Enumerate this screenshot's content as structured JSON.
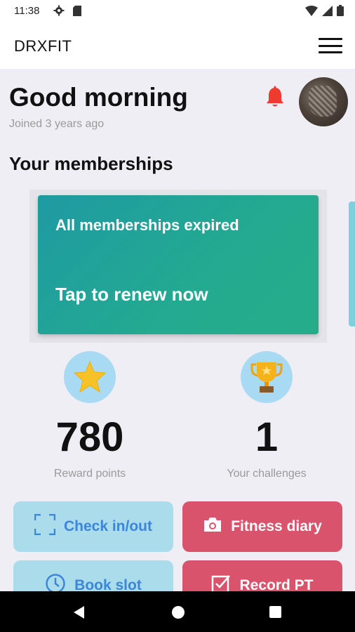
{
  "status_bar": {
    "time": "11:38",
    "icons_left": [
      "gear-icon",
      "sd-card-icon"
    ],
    "icons_right": [
      "wifi-icon",
      "signal-icon",
      "battery-icon"
    ]
  },
  "app_bar": {
    "title": "DRXFIT",
    "menu_icon": "hamburger-menu-icon"
  },
  "header": {
    "greeting": "Good morning",
    "joined": "Joined 3 years ago",
    "notification_icon": "bell-icon",
    "notification_color": "#ef3b2d"
  },
  "memberships": {
    "section_title": "Your memberships",
    "card": {
      "status": "All memberships expired",
      "action": "Tap to renew now",
      "color_start": "#1f9aa3",
      "color_end": "#25ad8a"
    }
  },
  "stats": [
    {
      "icon": "star-icon",
      "value": "780",
      "label": "Reward points"
    },
    {
      "icon": "trophy-icon",
      "value": "1",
      "label": "Your challenges"
    }
  ],
  "actions": [
    {
      "icon": "scan-frame-icon",
      "label": "Check in/out"
    },
    {
      "icon": "camera-icon",
      "label": "Fitness diary"
    },
    {
      "icon": "clock-icon",
      "label": "Book slot"
    },
    {
      "icon": "checkbox-icon",
      "label": "Record PT"
    }
  ],
  "colors": {
    "background": "#efeef4",
    "button_blue_bg": "#abdcec",
    "button_blue_text": "#3b86d9",
    "button_red_bg": "#d9536c",
    "stat_icon_bg": "#a9daf4"
  },
  "nav_bar": {
    "icons": [
      "back-icon",
      "home-icon",
      "recents-icon"
    ]
  }
}
